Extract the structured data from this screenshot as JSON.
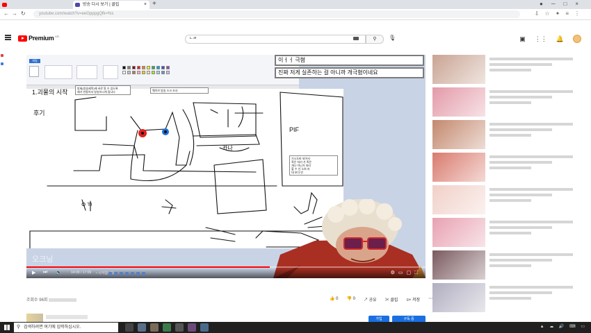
{
  "browser": {
    "tabs": [
      {
        "label": "",
        "favicon_color": "#ff0000",
        "active": false
      },
      {
        "label": "방송 다시 보기 | 클립",
        "favicon_color": "#4a4aa8",
        "active": true
      }
    ],
    "address": "youtube.com/watch?v=eeGpppgQfk=%s"
  },
  "youtube": {
    "logo_text": "Premium",
    "logo_region": "KR",
    "search_value": "ㄴㄹ"
  },
  "video": {
    "chat_line_1": "이ㅓㅓ 극혐",
    "chat_line_2": "진짜 저게 실존하는 걸 아니까 개극혐이네요",
    "note_top_left": [
      "방제(방송제목)에 바로 알 수 있도록",
      "제가 만들어서 방송하시게 됩니다"
    ],
    "note_top_mid": "웨이브 방송 스크 조사",
    "note_right": [
      "기시도바 되어서",
      "죽은 처리 가 죽은",
      "개나 아닌가 처리",
      "할 수 선 소여 라",
      "대 보다 만"
    ],
    "canvas_handwriting": [
      "1.괴물의 시작",
      "후기",
      "카나",
      "PIF",
      "ㅇㄲ"
    ],
    "watermark": "오크닝",
    "timecode": "14:09 / 17:09",
    "chapter": "• 시작합니다",
    "progress": 0.61
  },
  "below_video": {
    "views": "조회수 96회",
    "like_count": "0",
    "dislike_count": "0",
    "share_label": "공유",
    "clip_label": "클립",
    "save_label": "저장",
    "join_label": "가입",
    "subscribe_label": "구독 중"
  },
  "taskbar": {
    "search_placeholder": "검색하려면 여기에 입력하십시오."
  },
  "recommendations": [
    {
      "thumb_color": "#c9a493"
    },
    {
      "thumb_color": "#e39aa8"
    },
    {
      "thumb_color": "#c3886e"
    },
    {
      "thumb_color": "#d97b6e"
    },
    {
      "thumb_color": "#f1d0c8"
    },
    {
      "thumb_color": "#e8a1b2"
    },
    {
      "thumb_color": "#7a5a60"
    },
    {
      "thumb_color": "#b0aec0"
    }
  ]
}
